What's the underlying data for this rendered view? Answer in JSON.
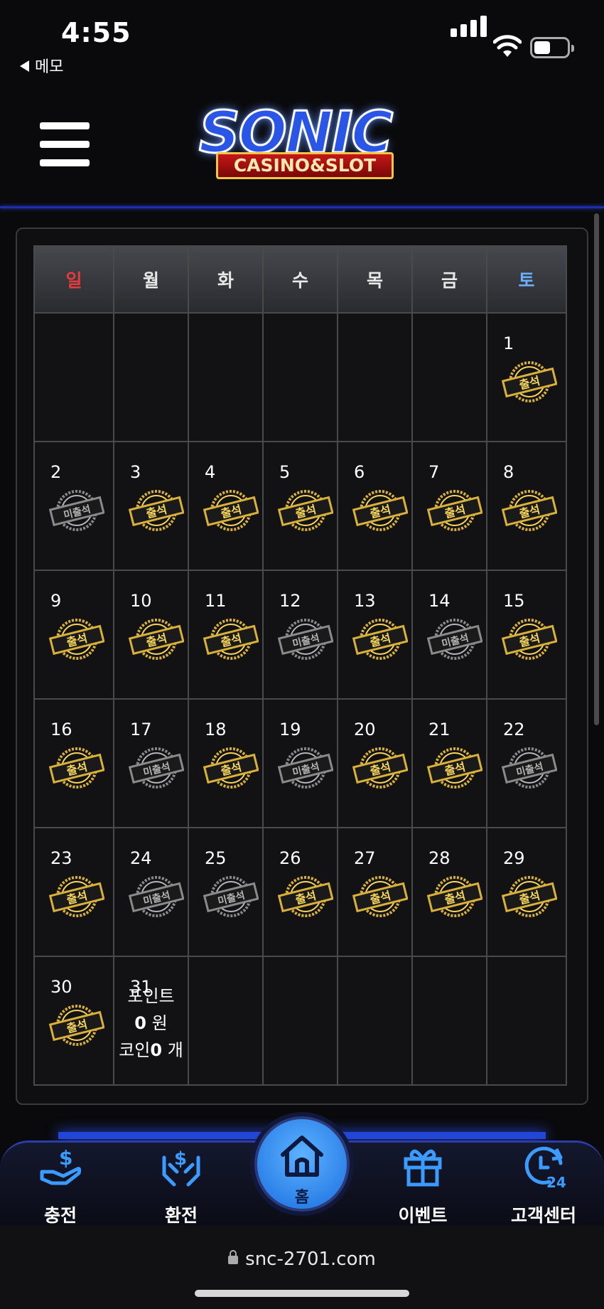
{
  "status_bar": {
    "time": "4:55",
    "back_label": "메모"
  },
  "header": {
    "logo_main": "SONIC",
    "logo_sub": "CASINO&SLOT"
  },
  "calendar": {
    "weekdays": [
      "일",
      "월",
      "화",
      "수",
      "목",
      "금",
      "토"
    ],
    "stamp_labels": {
      "attended": "출석",
      "absent": "미출석"
    },
    "weeks": [
      [
        null,
        null,
        null,
        null,
        null,
        null,
        {
          "day": "1",
          "status": "attended"
        }
      ],
      [
        {
          "day": "2",
          "status": "absent"
        },
        {
          "day": "3",
          "status": "attended"
        },
        {
          "day": "4",
          "status": "attended"
        },
        {
          "day": "5",
          "status": "attended"
        },
        {
          "day": "6",
          "status": "attended"
        },
        {
          "day": "7",
          "status": "attended"
        },
        {
          "day": "8",
          "status": "attended"
        }
      ],
      [
        {
          "day": "9",
          "status": "attended"
        },
        {
          "day": "10",
          "status": "attended"
        },
        {
          "day": "11",
          "status": "attended"
        },
        {
          "day": "12",
          "status": "absent"
        },
        {
          "day": "13",
          "status": "attended"
        },
        {
          "day": "14",
          "status": "absent"
        },
        {
          "day": "15",
          "status": "attended"
        }
      ],
      [
        {
          "day": "16",
          "status": "attended"
        },
        {
          "day": "17",
          "status": "absent"
        },
        {
          "day": "18",
          "status": "attended"
        },
        {
          "day": "19",
          "status": "absent"
        },
        {
          "day": "20",
          "status": "attended"
        },
        {
          "day": "21",
          "status": "attended"
        },
        {
          "day": "22",
          "status": "absent"
        }
      ],
      [
        {
          "day": "23",
          "status": "attended"
        },
        {
          "day": "24",
          "status": "absent"
        },
        {
          "day": "25",
          "status": "absent"
        },
        {
          "day": "26",
          "status": "attended"
        },
        {
          "day": "27",
          "status": "attended"
        },
        {
          "day": "28",
          "status": "attended"
        },
        {
          "day": "29",
          "status": "attended"
        }
      ],
      [
        {
          "day": "30",
          "status": "attended"
        },
        {
          "day": "31",
          "status": "overlay"
        },
        null,
        null,
        null,
        null,
        null
      ]
    ]
  },
  "points_overlay": {
    "line1": "포인트",
    "points_value": "0",
    "points_unit": " 원",
    "coin_label": "코인",
    "coin_value": "0",
    "coin_unit": " 개"
  },
  "bottom_nav": {
    "items": [
      {
        "label": "충전",
        "icon": "deposit-hand-icon"
      },
      {
        "label": "환전",
        "icon": "exchange-hands-icon"
      },
      {
        "label": "홈",
        "icon": "home-icon"
      },
      {
        "label": "이벤트",
        "icon": "gift-icon"
      },
      {
        "label": "고객센터",
        "icon": "support-24-icon"
      }
    ]
  },
  "browser": {
    "url": "snc-2701.com"
  },
  "colors": {
    "accent_blue": "#2a56e8",
    "gold": "#d9b13a",
    "sunday": "#e53b3b",
    "saturday": "#6ab0ff"
  }
}
